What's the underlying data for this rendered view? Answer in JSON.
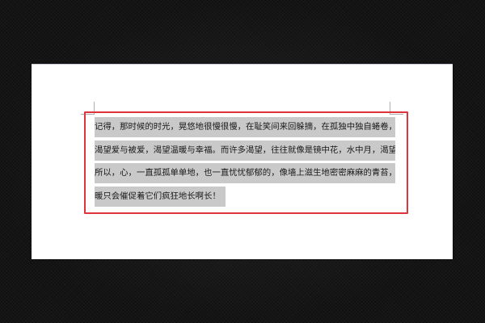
{
  "document": {
    "lines": [
      "记得，那时候的时光，晃悠地很慢很慢，在耻笑间来回躲摘，在孤独中独自蜷卷，在心底中",
      "渴望爱与被爱，渴望温暖与幸福。而许多渴望，往往就像是镜中花，水中月，渴望却不可及。",
      "所以，心，一直孤孤单单地，也一直忧忧郁郁的，像墙上滋生地密密麻麻的青苔，阳光的温",
      "暖只会催促着它们疯狂地长啊长！"
    ]
  },
  "colors": {
    "background": "#141414",
    "page": "#ffffff",
    "selection": "#c9c9c9",
    "highlight_border": "#e0343c",
    "text": "#1a1a1a"
  }
}
